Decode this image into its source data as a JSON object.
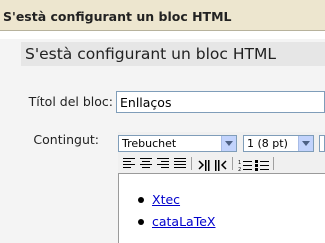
{
  "header": {
    "title": "S'està configurant un bloc HTML"
  },
  "section": {
    "heading": "S'està configurant un bloc HTML"
  },
  "form": {
    "title_label": "Títol del bloc:",
    "title_value": "Enllaços",
    "content_label": "Contingut:"
  },
  "editor": {
    "font_select": "Trebuchet",
    "size_select": "1 (8 pt)",
    "toolbar_buttons": [
      "align-left-icon",
      "align-center-icon",
      "align-right-icon",
      "align-justify-icon",
      "ltr-icon",
      "rtl-icon",
      "ordered-list-icon",
      "unordered-list-icon"
    ],
    "list_items": [
      "Xtec",
      "cataLaTeX"
    ]
  },
  "colors": {
    "header_bg": "#ede6cf",
    "section_bg": "#f4f4f4",
    "link": "#0000cc"
  }
}
